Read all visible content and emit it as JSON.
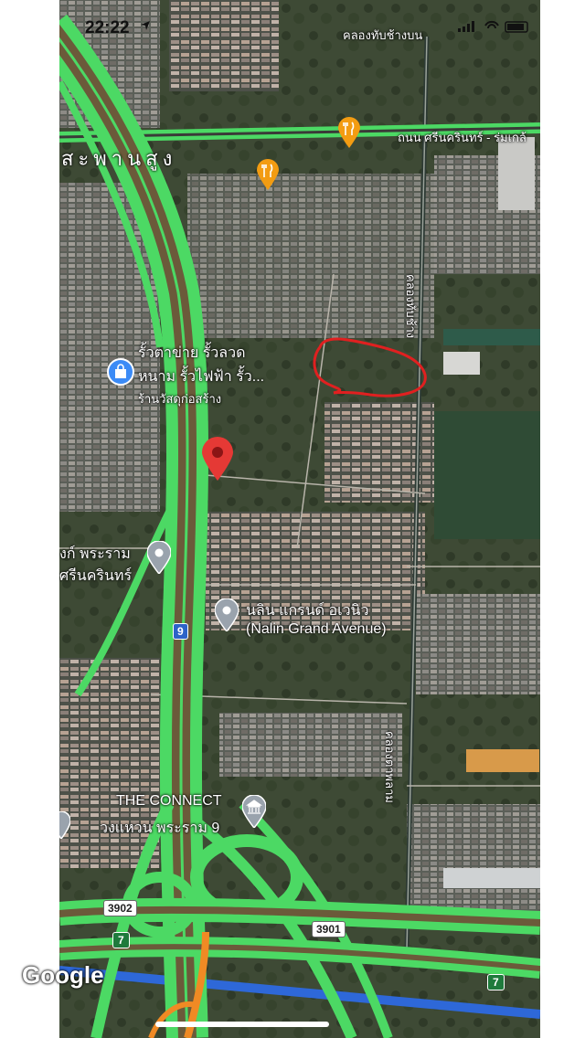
{
  "status": {
    "time": "22:22"
  },
  "labels": {
    "canal_top": "คลองทับช้างบน",
    "expressway": "สะพานสูง",
    "road_top": "ถนน ศรีนครินทร์ - ร่มเกล้",
    "canal_right_upper": "คลองทับช้าง",
    "shop_line1": "รั้วตาข่าย รั้วลวด",
    "shop_line2": "หนาม รั้วไฟฟ้า รั้ว...",
    "shop_category": "ร้านวัสดุก่อสร้าง",
    "place_left_line1": "งก์ พระราม",
    "place_left_line2": "ศรีนครินทร์",
    "nalin_line1": "นลิน แกรนด์ อเวนิว",
    "nalin_line2": "(Nalin Grand Avenue)",
    "canal_right_lower": "คลองตาพลาม",
    "connect_line1": "THE CONNECT",
    "connect_line2": "วงแหวน พระราม 9",
    "google": "Google"
  },
  "shields": {
    "route_9": "9",
    "route_3902": "3902",
    "route_3901": "3901",
    "exit_7a": "7",
    "exit_7b": "7"
  },
  "colors": {
    "traffic_free": "#4cd964",
    "pin_red": "#e53935",
    "poi_orange": "#f39c12",
    "poi_blue": "#3b8bf6",
    "annotation": "#e02020"
  },
  "icons": {
    "location": "location-arrow-icon",
    "restaurant": "fork-knife-icon",
    "shop": "shopping-bag-icon",
    "place": "place-pin-icon",
    "landmark": "museum-icon"
  }
}
